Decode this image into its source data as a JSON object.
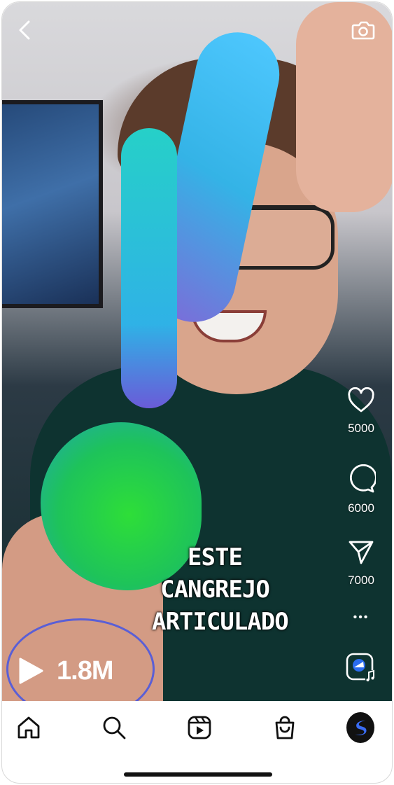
{
  "app": {
    "accent": "#5a5fd6"
  },
  "header": {
    "back_icon": "chevron-left-icon",
    "camera_icon": "camera-icon"
  },
  "video": {
    "caption_lines": [
      "ESTE",
      "CANGREJO",
      "ARTICULADO"
    ],
    "views": {
      "icon": "play-icon",
      "count": "1.8M"
    }
  },
  "actions": {
    "like": {
      "icon": "heart-icon",
      "count": "5000"
    },
    "comment": {
      "icon": "comment-icon",
      "count": "6000"
    },
    "share": {
      "icon": "send-icon",
      "count": "7000"
    },
    "more": {
      "icon": "more-dots-icon",
      "label": "•••"
    },
    "audio": {
      "icon": "audio-track-icon"
    }
  },
  "tabbar": {
    "items": [
      {
        "icon": "home-icon"
      },
      {
        "icon": "search-icon"
      },
      {
        "icon": "reels-icon"
      },
      {
        "icon": "shop-icon"
      },
      {
        "icon": "profile-avatar-icon"
      }
    ]
  }
}
